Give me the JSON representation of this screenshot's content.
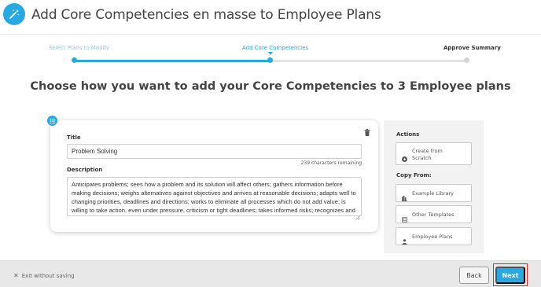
{
  "header": {
    "title": "Add Core Competencies en masse to Employee Plans",
    "icon": "magic-wand-icon"
  },
  "stepper": {
    "steps": [
      {
        "label": "Select Plans to Modify",
        "state": "completed"
      },
      {
        "label": "Add Core Competencies",
        "state": "current"
      },
      {
        "label": "Approve Summary",
        "state": "upcoming"
      }
    ],
    "progress_percent": 50
  },
  "headline": "Choose how you want to add your Core Competencies to 3 Employee plans",
  "competency": {
    "title_label": "Title",
    "title_value": "Problem Solving",
    "chars_remaining": "239 characters remaining",
    "description_label": "Description",
    "description_value": "Anticipates problems; sees how a problem and its solution will affect others; gathers information before making decisions; weighs alternatives against objectives and arrives at reasonable decisions; adapts well to changing priorities, deadlines and directions; works to eliminate all processes which do not add value; is willing to take action, even under pressure, criticism or tight deadlines; takes informed risks; recognizes and accurately evaluates the signs of a problem."
  },
  "actions_panel": {
    "actions_heading": "Actions",
    "create_from_scratch": "Create from Scratch",
    "copy_from_heading": "Copy From:",
    "example_library": "Example Library",
    "other_templates": "Other Templates",
    "employee_plans": "Employee Plans"
  },
  "footer": {
    "exit_label": "Exit without saving",
    "back_label": "Back",
    "next_label": "Next"
  },
  "colors": {
    "accent": "#27a9e1",
    "highlight": "#e0282f"
  }
}
